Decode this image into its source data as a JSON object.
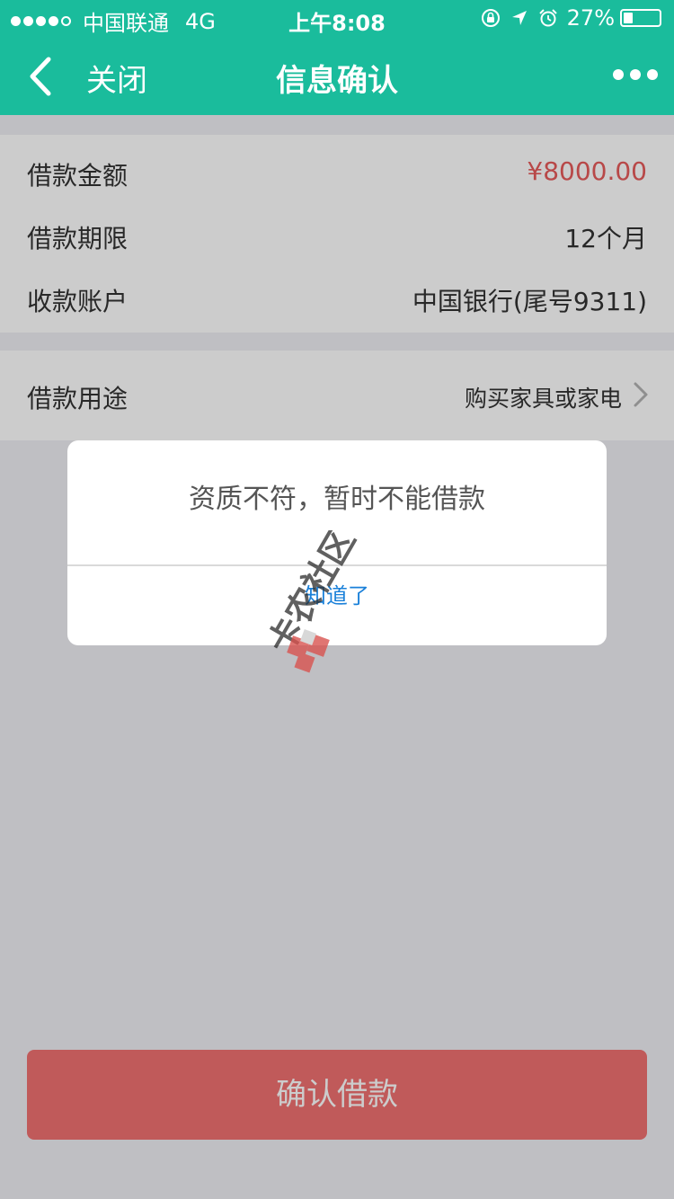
{
  "status_bar": {
    "carrier": "中国联通",
    "network": "4G",
    "time": "上午8:08",
    "battery_percent": "27%",
    "battery_fill": 0.27,
    "icons": [
      "lock-rotation-icon",
      "location-arrow-icon",
      "alarm-icon",
      "battery-icon"
    ]
  },
  "nav": {
    "back_icon": "chevron-left-icon",
    "close_label": "关闭",
    "title": "信息确认",
    "more_icon": "more-dots-icon"
  },
  "details": {
    "amount_label": "借款金额",
    "amount_value": "¥8000.00",
    "term_label": "借款期限",
    "term_value": "12个月",
    "account_label": "收款账户",
    "account_value": "中国银行(尾号9311)"
  },
  "purpose": {
    "label": "借款用途",
    "value": "购买家具或家电",
    "icon": "chevron-right-icon"
  },
  "confirm_button": "确认借款",
  "dialog": {
    "message": "资质不符，暂时不能借款",
    "button": "知道了"
  },
  "watermark": {
    "text": "卡农社区"
  },
  "colors": {
    "accent": "#1abc9c",
    "amount_red": "#e65a5a",
    "confirm_button": "#f07171",
    "dialog_button_blue": "#1a80d9"
  }
}
